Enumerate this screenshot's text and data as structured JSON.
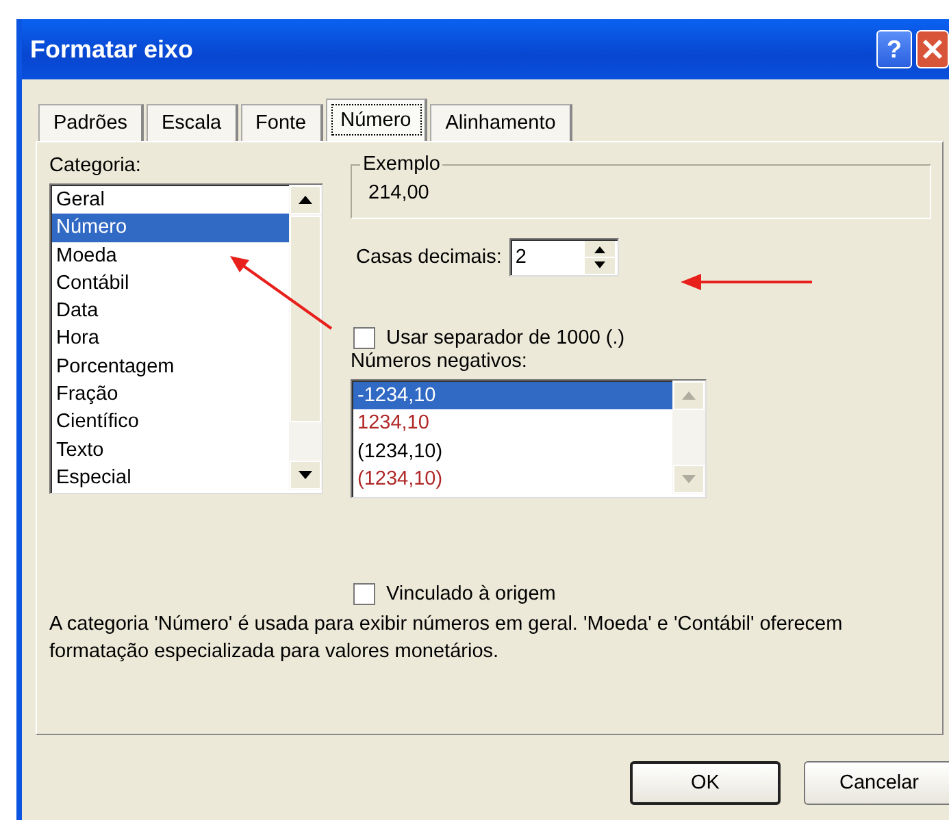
{
  "window": {
    "title": "Formatar eixo",
    "help_button": "?"
  },
  "tabs": [
    {
      "label": "Padrões",
      "selected": false
    },
    {
      "label": "Escala",
      "selected": false
    },
    {
      "label": "Fonte",
      "selected": false
    },
    {
      "label": "Número",
      "selected": true
    },
    {
      "label": "Alinhamento",
      "selected": false
    }
  ],
  "category": {
    "label": "Categoria:",
    "items": [
      {
        "label": "Geral",
        "selected": false
      },
      {
        "label": "Número",
        "selected": true
      },
      {
        "label": "Moeda",
        "selected": false
      },
      {
        "label": "Contábil",
        "selected": false
      },
      {
        "label": "Data",
        "selected": false
      },
      {
        "label": "Hora",
        "selected": false
      },
      {
        "label": "Porcentagem",
        "selected": false
      },
      {
        "label": "Fração",
        "selected": false
      },
      {
        "label": "Científico",
        "selected": false
      },
      {
        "label": "Texto",
        "selected": false
      },
      {
        "label": "Especial",
        "selected": false
      }
    ]
  },
  "example": {
    "label": "Exemplo",
    "value": "214,00"
  },
  "decimal_places": {
    "label": "Casas decimais:",
    "value": "2"
  },
  "thousands_separator": {
    "label": "Usar separador de 1000 (.)",
    "checked": false
  },
  "negative_numbers": {
    "label": "Números negativos:",
    "items": [
      {
        "label": "-1234,10",
        "selected": true
      },
      {
        "label": "1234,10",
        "selected": false,
        "color": "#b02828"
      },
      {
        "label": "(1234,10)",
        "selected": false
      },
      {
        "label": "(1234,10)",
        "selected": false,
        "color": "#b02828"
      }
    ]
  },
  "linked_to_source": {
    "label": "Vinculado à origem",
    "checked": false
  },
  "description": "A categoria 'Número' é usada para exibir números em geral. 'Moeda' e 'Contábil' oferecem formatação especializada para valores monetários.",
  "buttons": [
    {
      "label": "OK",
      "default": true
    },
    {
      "label": "Cancelar",
      "default": false
    }
  ]
}
